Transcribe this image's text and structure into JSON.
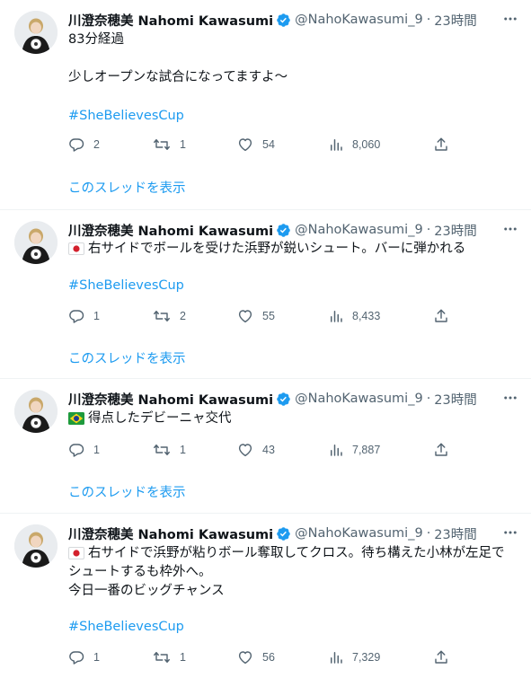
{
  "colors": {
    "link": "#1d9bf0",
    "muted": "#536471",
    "text": "#0f1419",
    "verified": "#1d9bf0",
    "divider": "#eff3f4"
  },
  "tweets": [
    {
      "user_name": "川澄奈穂美 Nahomi Kawasumi",
      "handle": "@NahoKawasumi_9",
      "separator": "·",
      "time": "23時間",
      "lines": [
        "83分経過",
        "",
        "少しオープンな試合になってますよ～"
      ],
      "flag_icon": "",
      "hashtag": "#SheBelievesCup",
      "replies": "2",
      "retweets": "1",
      "likes": "54",
      "views": "8,060",
      "show_thread": "このスレッドを表示"
    },
    {
      "user_name": "川澄奈穂美 Nahomi Kawasumi",
      "handle": "@NahoKawasumi_9",
      "separator": "·",
      "time": "23時間",
      "lines": [
        "右サイドでボールを受けた浜野が鋭いシュート。バーに弾かれる"
      ],
      "flag_icon": "japan-flag-icon",
      "hashtag": "#SheBelievesCup",
      "replies": "1",
      "retweets": "2",
      "likes": "55",
      "views": "8,433",
      "show_thread": "このスレッドを表示"
    },
    {
      "user_name": "川澄奈穂美 Nahomi Kawasumi",
      "handle": "@NahoKawasumi_9",
      "separator": "·",
      "time": "23時間",
      "lines": [
        "得点したデビーニャ交代"
      ],
      "flag_icon": "brazil-flag-icon",
      "hashtag": "",
      "replies": "1",
      "retweets": "1",
      "likes": "43",
      "views": "7,887",
      "show_thread": "このスレッドを表示"
    },
    {
      "user_name": "川澄奈穂美 Nahomi Kawasumi",
      "handle": "@NahoKawasumi_9",
      "separator": "·",
      "time": "23時間",
      "lines": [
        "右サイドで浜野が粘りボール奪取してクロス。待ち構えた小林が左足で",
        "シュートするも枠外へ。",
        "今日一番のビッグチャンス"
      ],
      "flag_icon": "japan-flag-icon",
      "hashtag": "#SheBelievesCup",
      "replies": "1",
      "retweets": "1",
      "likes": "56",
      "views": "7,329",
      "show_thread": ""
    }
  ]
}
